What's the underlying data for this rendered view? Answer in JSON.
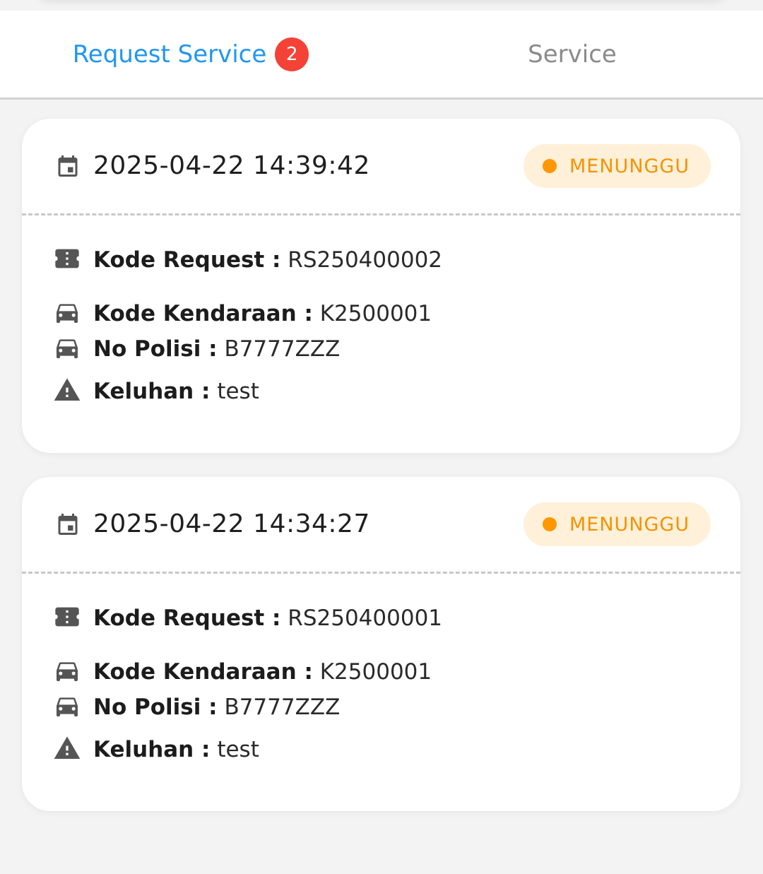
{
  "tabs": {
    "request": {
      "label": "Request Service",
      "badge": "2"
    },
    "service": {
      "label": "Service"
    }
  },
  "colors": {
    "active_tab": "#2196f3",
    "badge": "#f44336",
    "status_accent": "#ff9800",
    "status_bg": "#fff0d9"
  },
  "labels": {
    "kode_request": "Kode Request :",
    "kode_kendaraan": "Kode Kendaraan :",
    "no_polisi": "No Polisi :",
    "keluhan": "Keluhan :"
  },
  "requests": [
    {
      "datetime": "2025-04-22 14:39:42",
      "status": "MENUNGGU",
      "kode_request": "RS250400002",
      "kode_kendaraan": "K2500001",
      "no_polisi": "B7777ZZZ",
      "keluhan": "test"
    },
    {
      "datetime": "2025-04-22 14:34:27",
      "status": "MENUNGGU",
      "kode_request": "RS250400001",
      "kode_kendaraan": "K2500001",
      "no_polisi": "B7777ZZZ",
      "keluhan": "test"
    }
  ],
  "icons": {
    "date": "calendar-icon",
    "kode_request": "ticket-icon",
    "kendaraan": "car-icon",
    "keluhan": "warning-icon"
  }
}
